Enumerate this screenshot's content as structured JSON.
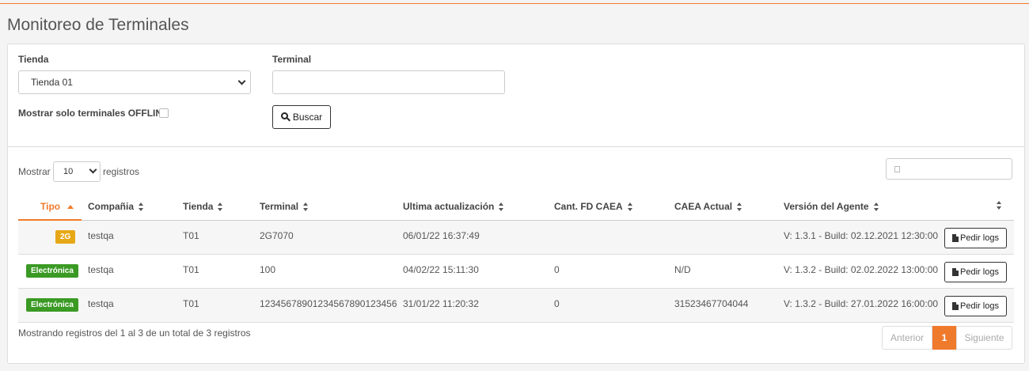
{
  "page": {
    "title": "Monitoreo de Terminales"
  },
  "colors": {
    "accent": "#f07a2b",
    "badge_2g": "#e6a817",
    "badge_electronica": "#3a9a24"
  },
  "filters": {
    "store_label": "Tienda",
    "store_value": "Tienda 01",
    "terminal_label": "Terminal",
    "terminal_value": "",
    "offline_label": "Mostrar solo terminales OFFLINE",
    "offline_checked": false,
    "search_button": "Buscar"
  },
  "table_controls": {
    "show_prefix": "Mostrar",
    "page_length": "10",
    "show_suffix": "registros",
    "filter_value": ""
  },
  "table": {
    "columns": [
      "Tipo",
      "Compañia",
      "Tienda",
      "Terminal",
      "Ultima actualización",
      "Cant. FD CAEA",
      "CAEA Actual",
      "Versión del Agente"
    ],
    "sorted_column": "Tipo",
    "sort_direction": "asc",
    "rows": [
      {
        "tipo": "2G",
        "compania": "testqa",
        "tienda": "T01",
        "terminal": "2G7070",
        "ultima": "06/01/22 16:37:49",
        "cant": "",
        "caea": "",
        "version": "V: 1.3.1 - Build: 02.12.2021 12:30:00",
        "action": "Pedir logs"
      },
      {
        "tipo": "Electrónica",
        "compania": "testqa",
        "tienda": "T01",
        "terminal": "100",
        "ultima": "04/02/22 15:11:30",
        "cant": "0",
        "caea": "N/D",
        "version": "V: 1.3.2 - Build: 02.02.2022 13:00:00",
        "action": "Pedir logs"
      },
      {
        "tipo": "Electrónica",
        "compania": "testqa",
        "tienda": "T01",
        "terminal": "12345678901234567890123456",
        "ultima": "31/01/22 11:20:32",
        "cant": "0",
        "caea": "31523467704044",
        "version": "V: 1.3.2 - Build: 27.01.2022 16:00:00",
        "action": "Pedir logs"
      }
    ]
  },
  "footer": {
    "info": "Mostrando registros del 1 al 3 de un total de 3 registros",
    "prev": "Anterior",
    "current_page": "1",
    "next": "Siguiente"
  }
}
